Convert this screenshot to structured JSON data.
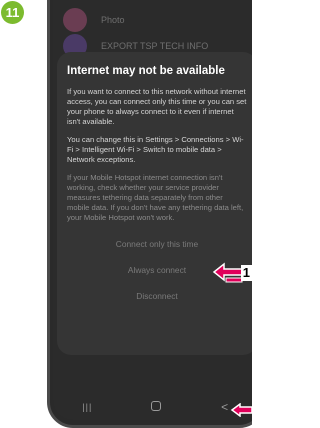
{
  "step": {
    "number": "11",
    "color": "#7cbb2e"
  },
  "background_list": {
    "items": [
      {
        "text": "Photo",
        "icon": "avatar-icon"
      },
      {
        "text": "EXPORT TSP TECH INFO",
        "icon": "avatar-icon"
      }
    ]
  },
  "dialog": {
    "title": "Internet may not be available",
    "paragraph1": "If you want to connect to this network without internet access, you can connect only this time or you can set your phone to always connect to it even if internet isn't available.",
    "paragraph2": "You can change this in Settings > Connections > Wi-Fi > Intelligent Wi-Fi > Switch to mobile data > Network exceptions.",
    "paragraph3": "If your Mobile Hotspot internet connection isn't working, check whether your service provider measures tethering data separately from other mobile data. If you don't have any tethering data left, your Mobile Hotspot won't work.",
    "buttons": {
      "connect_once": "Connect only this time",
      "always_connect": "Always connect",
      "disconnect": "Disconnect"
    }
  },
  "navbar": {
    "recents": "|||",
    "home": "",
    "back": "<"
  },
  "callouts": {
    "first": "1",
    "second": ""
  },
  "colors": {
    "callout_arrow": "#e0005a",
    "dialog_bg": "#353535",
    "screen_bg": "#2b2b2b"
  }
}
